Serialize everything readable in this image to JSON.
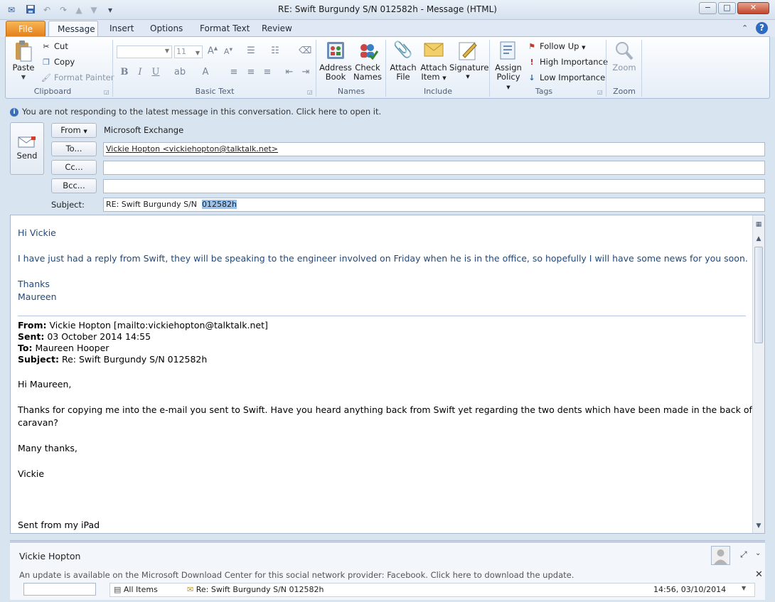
{
  "window": {
    "title": "RE: Swift Burgundy S/N  012582h  -  Message (HTML)",
    "minimize_glyph": "−",
    "maximize_glyph": "□",
    "close_glyph": "✕"
  },
  "tabs": {
    "file": "File",
    "message": "Message",
    "insert": "Insert",
    "options": "Options",
    "format_text": "Format Text",
    "review": "Review"
  },
  "ribbon": {
    "clipboard": {
      "paste": "Paste",
      "cut": "Cut",
      "copy": "Copy",
      "format_painter": "Format Painter",
      "label": "Clipboard"
    },
    "basic_text": {
      "font_size": "11",
      "bold": "B",
      "italic": "I",
      "underline": "U",
      "label": "Basic Text"
    },
    "names": {
      "address_book_line1": "Address",
      "address_book_line2": "Book",
      "check_names_line1": "Check",
      "check_names_line2": "Names",
      "label": "Names"
    },
    "include": {
      "attach_file_line1": "Attach",
      "attach_file_line2": "File",
      "attach_item_line1": "Attach",
      "attach_item_line2": "Item",
      "signature": "Signature",
      "label": "Include"
    },
    "tags": {
      "assign_policy_line1": "Assign",
      "assign_policy_line2": "Policy",
      "follow_up": "Follow Up",
      "high_importance": "High Importance",
      "low_importance": "Low Importance",
      "label": "Tags"
    },
    "zoom": {
      "zoom": "Zoom",
      "label": "Zoom"
    }
  },
  "infobar": {
    "text": "You are not responding to the latest message in this conversation. Click here to open it."
  },
  "header": {
    "send": "Send",
    "from_button": "From",
    "from_value": "Microsoft Exchange",
    "to_button": "To...",
    "to_value": "Vickie Hopton <vickiehopton@talktalk.net>",
    "cc_button": "Cc...",
    "cc_value": "",
    "bcc_button": "Bcc...",
    "bcc_value": "",
    "subject_label": "Subject:",
    "subject_prefix": "RE: Swift Burgundy S/N",
    "subject_selected": "012582h"
  },
  "body": {
    "greeting": "Hi Vickie",
    "paragraph": "I have just had a reply from Swift, they will be speaking to the engineer involved on Friday when he is in the office, so hopefully I will have some news for you soon.",
    "thanks": "Thanks",
    "signoff": "Maureen",
    "orig_from_label": "From:",
    "orig_from": "Vickie Hopton [mailto:vickiehopton@talktalk.net]",
    "orig_sent_label": "Sent:",
    "orig_sent": "03 October 2014 14:55",
    "orig_to_label": "To:",
    "orig_to": "Maureen Hooper",
    "orig_subject_label": "Subject:",
    "orig_subject": "Re: Swift Burgundy S/N 012582h",
    "orig_greeting": "Hi Maureen,",
    "orig_para_line1": "Thanks for copying me into the e-mail you sent to Swift.  Have you heard anything back from Swift yet regarding the two dents which have been made in the back of our",
    "orig_para_line2": "caravan?",
    "orig_thanks": "Many thanks,",
    "orig_name": "Vickie",
    "orig_footer": "Sent from my iPad"
  },
  "people_pane": {
    "name": "Vickie Hopton",
    "update_notice": "An update is available on the Microsoft Download Center for this social network provider: Facebook. Click here to download the update.",
    "all_items": "All Items",
    "item_subject": "Re: Swift Burgundy S/N 012582h",
    "item_time": "14:56, 03/10/2014"
  },
  "colors": {
    "reply_text": "#1f497d",
    "file_tab": "#e4801a",
    "selection": "#99c2ef"
  }
}
